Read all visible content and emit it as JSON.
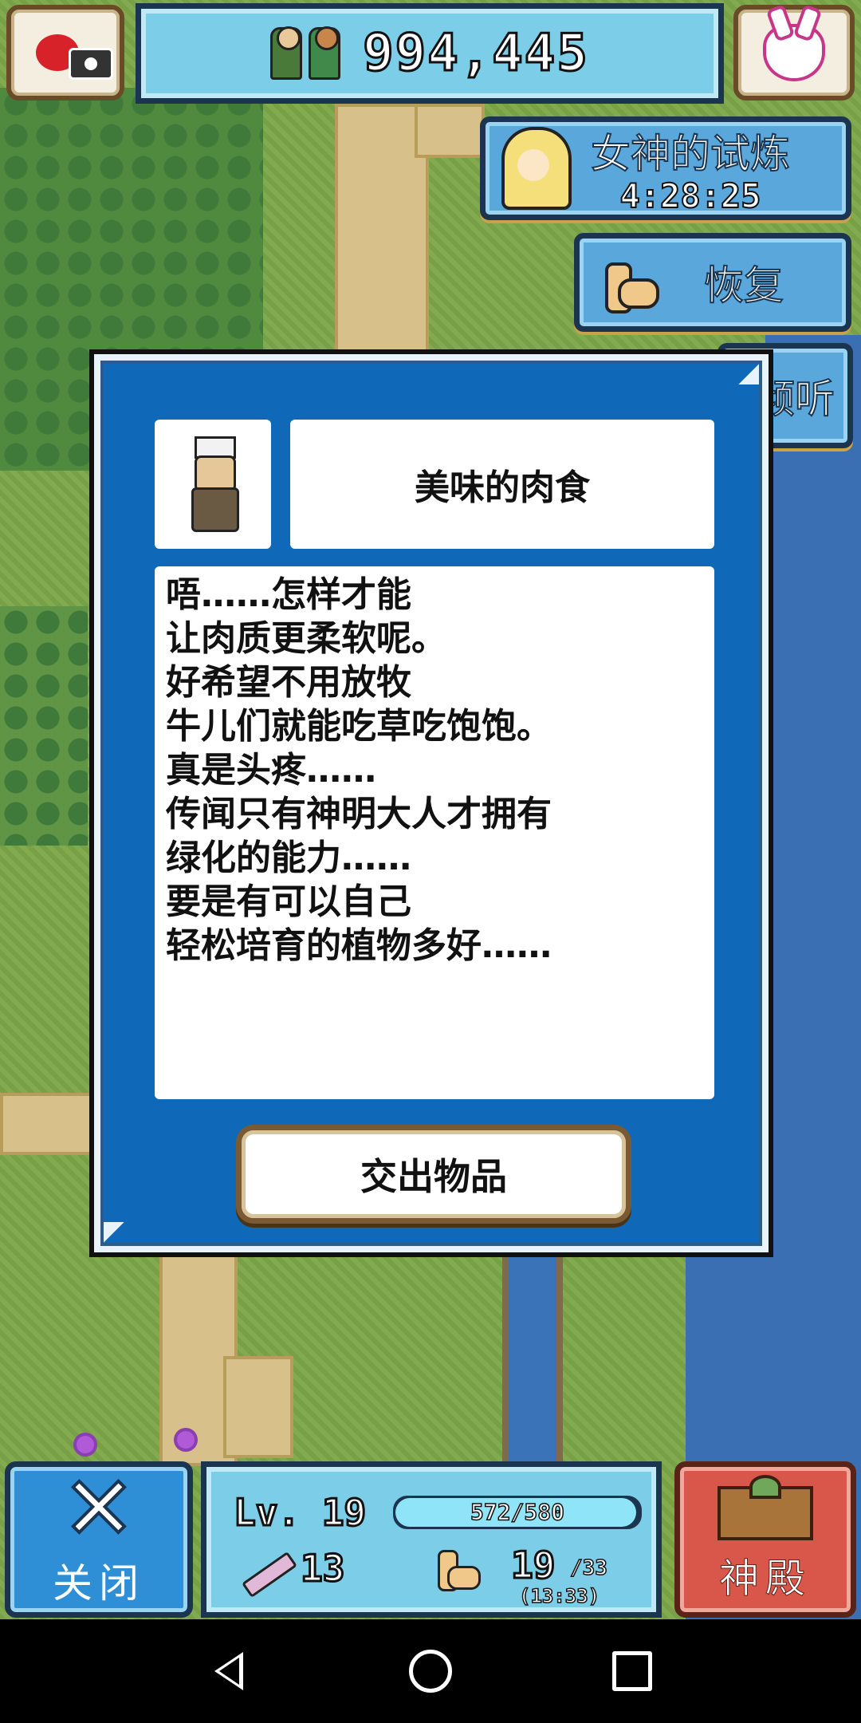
{
  "top_bar": {
    "currency_value": "994,445"
  },
  "side_buttons": {
    "trial_title": "女神的试炼",
    "trial_timer": "4:28:25",
    "recover_label": "恢复",
    "listen_label": "倾听"
  },
  "dialog": {
    "title": "美味的肉食",
    "body_lines": [
      "唔……怎样才能",
      "让肉质更柔软呢。",
      "好希望不用放牧",
      "牛儿们就能吃草吃饱饱。",
      "真是头疼……",
      "传闻只有神明大人才拥有",
      "绿化的能力……",
      "要是有可以自己",
      "轻松培育的植物多好……"
    ],
    "submit_label": "交出物品"
  },
  "status": {
    "level": "Lv. 19",
    "xp_text": "572/580",
    "xp_fraction": 0.986,
    "attack": "13",
    "stamina_current": "19",
    "stamina_max": "/33",
    "stamina_timer": "(13:33)"
  },
  "bottom": {
    "close_label": "关闭",
    "temple_label": "神殿"
  },
  "colors": {
    "dialog_blue": "#0f68b8",
    "button_blue": "#5aa7dc",
    "temple_red": "#d8564a"
  }
}
